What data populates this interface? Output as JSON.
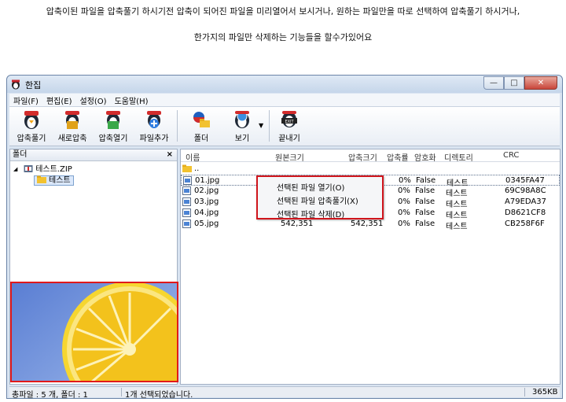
{
  "captions": {
    "line1": "압축이된 파일을 압축풀기 하시기전 압축이 되어진 파일을 미리열어서 보시거나, 원하는 파일만을 따로 선택하여 압축풀기 하시거나,",
    "line2": "한가지의 파일만 삭제하는 기능들을 할수가있어요"
  },
  "window": {
    "title": "한집",
    "controls": {
      "minimize": "—",
      "maximize": "□",
      "close": "✕"
    }
  },
  "menubar": [
    "파일(F)",
    "편집(E)",
    "설정(O)",
    "도움말(H)"
  ],
  "toolbar": [
    {
      "label": "압축풀기",
      "icon": "penguin-extract-icon"
    },
    {
      "label": "새로압축",
      "icon": "penguin-new-archive-icon"
    },
    {
      "label": "압축열기",
      "icon": "penguin-open-archive-icon"
    },
    {
      "label": "파일추가",
      "icon": "penguin-add-file-icon"
    },
    {
      "label": "폴더",
      "icon": "folder-icon"
    },
    {
      "label": "보기",
      "icon": "penguin-view-icon"
    },
    {
      "label": "끝내기",
      "icon": "penguin-exit-icon"
    }
  ],
  "folder_pane": {
    "title": "폴더",
    "close": "×",
    "tree": [
      {
        "label": "테스트.ZIP",
        "expander": "◢"
      },
      {
        "label": "테스트"
      }
    ]
  },
  "file_list": {
    "columns": [
      "이름",
      "원본크기",
      "압축크기",
      "압축률",
      "암호화",
      "디렉토리",
      "CRC"
    ],
    "parent": "..",
    "rows": [
      {
        "name": "01.jpg",
        "original": "",
        "compressed": "",
        "ratio": "0%",
        "encrypted": "False",
        "dir": "테스트",
        "crc": "0345FA47"
      },
      {
        "name": "02.jpg",
        "original": "",
        "compressed": "",
        "ratio": "0%",
        "encrypted": "False",
        "dir": "테스트",
        "crc": "69C98A8C"
      },
      {
        "name": "03.jpg",
        "original": "",
        "compressed": "",
        "ratio": "0%",
        "encrypted": "False",
        "dir": "테스트",
        "crc": "A79EDA37"
      },
      {
        "name": "04.jpg",
        "original": "",
        "compressed": "",
        "ratio": "0%",
        "encrypted": "False",
        "dir": "테스트",
        "crc": "D8621CF8"
      },
      {
        "name": "05.jpg",
        "original": "542,351",
        "compressed": "542,351",
        "ratio": "0%",
        "encrypted": "False",
        "dir": "테스트",
        "crc": "CB258F6F"
      }
    ]
  },
  "context_menu": [
    "선택된 파일 열기(O)",
    "선택된 파일 압축풀기(X)",
    "선택된 파일 삭제(D)"
  ],
  "statusbar": {
    "counts": "총파일 : 5 개, 폴더 : 1",
    "selection": "1개 선택되었습니다.",
    "size": "365KB"
  },
  "colors": {
    "highlight_border": "#d0151c",
    "title_bar": "#c5d6ea",
    "selection": "#dbe8fb"
  }
}
